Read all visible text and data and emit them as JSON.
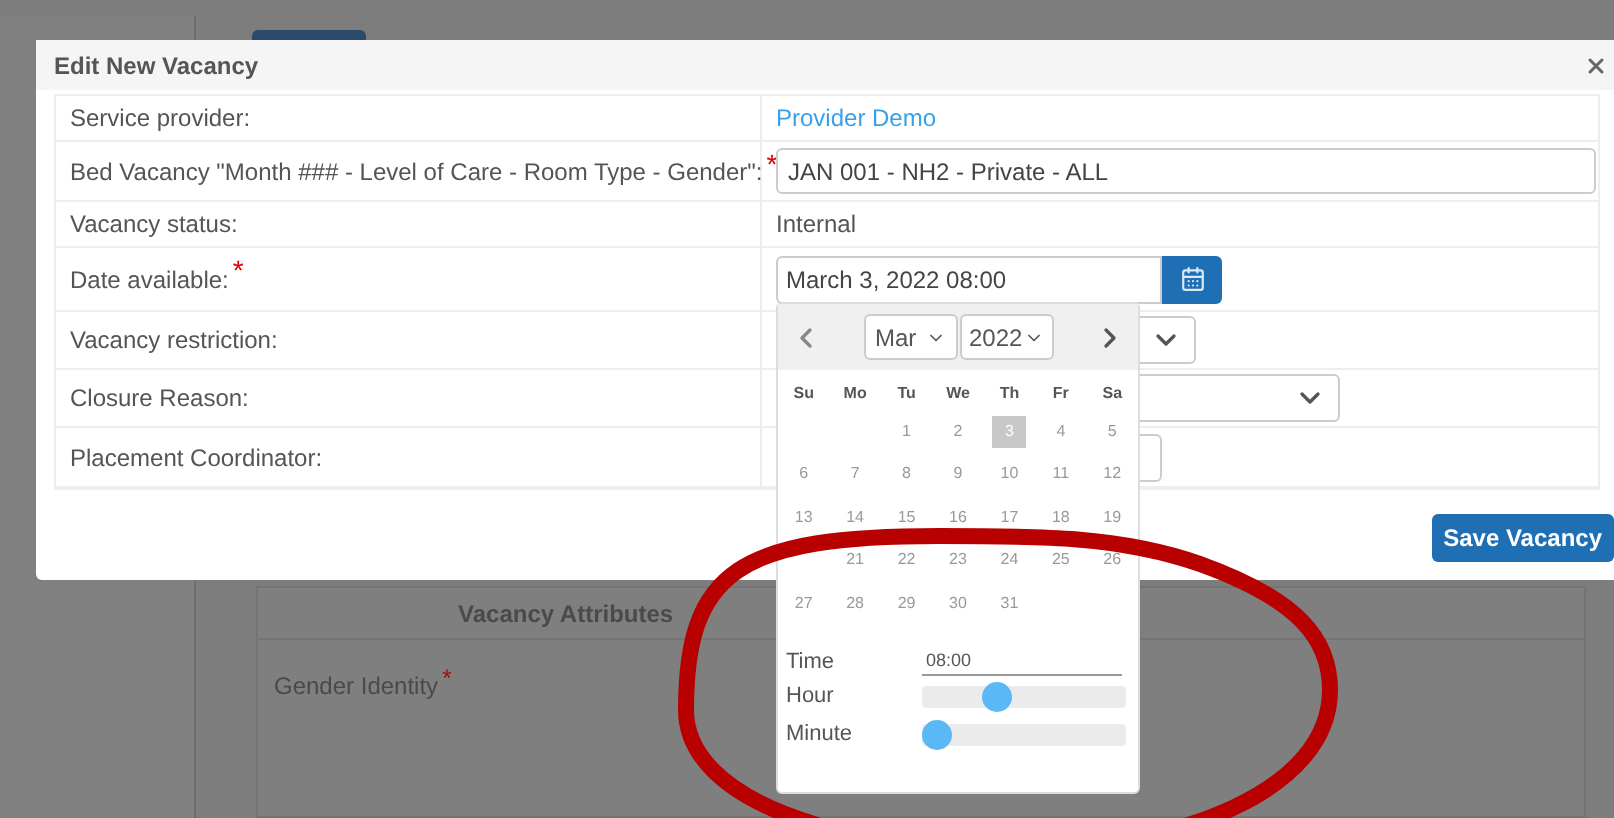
{
  "background": {
    "panel_title": "Vacancy Attributes",
    "field_label": "Gender Identity",
    "required_mark": "*"
  },
  "modal": {
    "title": "Edit New Vacancy",
    "rows": [
      {
        "label": "Service provider:",
        "kind": "link",
        "value": "Provider Demo"
      },
      {
        "label": "Bed Vacancy \"Month ### - Level of Care - Room Type - Gender\":",
        "required_mark": "*",
        "kind": "input",
        "value": "JAN 001 - NH2 - Private - ALL"
      },
      {
        "label": "Vacancy status:",
        "kind": "text",
        "value": "Internal"
      },
      {
        "label": "Date available:",
        "required_mark": "*",
        "kind": "date",
        "value": "March 3, 2022 08:00"
      },
      {
        "label": "Vacancy restriction:",
        "kind": "select",
        "wide": false
      },
      {
        "label": "Closure Reason:",
        "kind": "select",
        "wide": true
      },
      {
        "label": "Placement Coordinator:",
        "kind": "button"
      }
    ],
    "save_button": "Save Vacancy"
  },
  "datepicker": {
    "month": "Mar",
    "year": "2022",
    "weekdays": [
      "Su",
      "Mo",
      "Tu",
      "We",
      "Th",
      "Fr",
      "Sa"
    ],
    "weeks": [
      [
        {
          "label": "1",
          "selected": false
        },
        {
          "label": "2",
          "selected": false
        },
        {
          "label": "3",
          "selected": true
        },
        {
          "label": "4",
          "selected": false
        },
        {
          "label": "5",
          "selected": false
        }
      ],
      [
        {
          "label": "6",
          "selected": false
        },
        {
          "label": "7",
          "selected": false
        },
        {
          "label": "8",
          "selected": false
        },
        {
          "label": "9",
          "selected": false
        },
        {
          "label": "10",
          "selected": false
        },
        {
          "label": "11",
          "selected": false
        },
        {
          "label": "12",
          "selected": false
        }
      ],
      [
        {
          "label": "13",
          "selected": false
        },
        {
          "label": "14",
          "selected": false
        },
        {
          "label": "15",
          "selected": false
        },
        {
          "label": "16",
          "selected": false
        },
        {
          "label": "17",
          "selected": false
        },
        {
          "label": "18",
          "selected": false
        },
        {
          "label": "19",
          "selected": false
        }
      ],
      [
        {
          "label": "21",
          "selected": false
        },
        {
          "label": "22",
          "selected": false
        },
        {
          "label": "23",
          "selected": false
        },
        {
          "label": "24",
          "selected": false
        },
        {
          "label": "25",
          "selected": false
        },
        {
          "label": "26",
          "selected": false
        }
      ],
      [
        {
          "label": "27",
          "selected": false
        },
        {
          "label": "28",
          "selected": false
        },
        {
          "label": "29",
          "selected": false
        },
        {
          "label": "30",
          "selected": false
        },
        {
          "label": "31",
          "selected": false
        }
      ]
    ],
    "time_label": "Time",
    "time_value": "08:00",
    "sliders": [
      {
        "label": "Hour",
        "level": 0.35
      },
      {
        "label": "Minute",
        "level": 0
      }
    ]
  }
}
